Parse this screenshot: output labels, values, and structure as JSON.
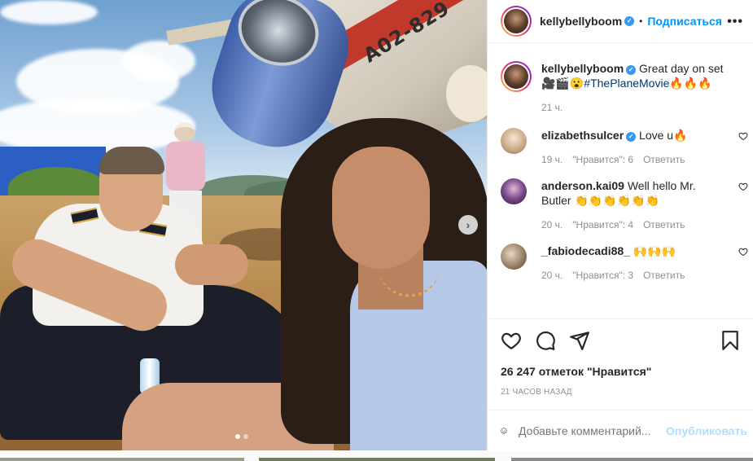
{
  "post": {
    "author": "kellybellyboom",
    "follow_label": "Подписаться",
    "dot": "•",
    "more": "•••",
    "photo": {
      "registration_text": "A02-829",
      "carousel_count": 2,
      "carousel_active": 1
    },
    "caption": {
      "author": "kellybellyboom",
      "text": "Great day on set 🎥🎬😮",
      "hashtag": "#ThePlaneMovie",
      "emoji_tail": "🔥🔥🔥",
      "time": "21 ч."
    },
    "comments": [
      {
        "user": "elizabethsulcer",
        "verified": true,
        "text": "Love u🔥",
        "time": "19 ч.",
        "likes": "\"Нравится\": 6",
        "reply": "Ответить",
        "avatar_color": "#d9c2a7"
      },
      {
        "user": "anderson.kai09",
        "verified": false,
        "text": "Well hello Mr. Butler 👏👏👏👏👏👏",
        "time": "20 ч.",
        "likes": "\"Нравится\": 4",
        "reply": "Ответить",
        "avatar_color": "#5b3c6b"
      },
      {
        "user": "_fabiodecadi88_",
        "verified": false,
        "text": "🙌🙌🙌",
        "time": "20 ч.",
        "likes": "\"Нравится\": 3",
        "reply": "Ответить",
        "avatar_color": "#b9a58d"
      }
    ],
    "likes_label": "26 247 отметок \"Нравится\"",
    "posted_ago": "21 ЧАСОВ НАЗАД",
    "comment_placeholder": "Добавьте комментарий...",
    "publish_label": "Опубликовать"
  },
  "icons": {
    "verified": "verified-badge-icon",
    "like": "heart-icon",
    "comment": "comment-bubble-icon",
    "share": "paper-plane-icon",
    "save": "bookmark-icon",
    "emoji": "smiley-icon",
    "next": "chevron-right-icon"
  },
  "colors": {
    "link": "#0095f6",
    "hashtag": "#00376b",
    "muted": "#8e8e8e",
    "publish_disabled": "#b2dffc"
  }
}
